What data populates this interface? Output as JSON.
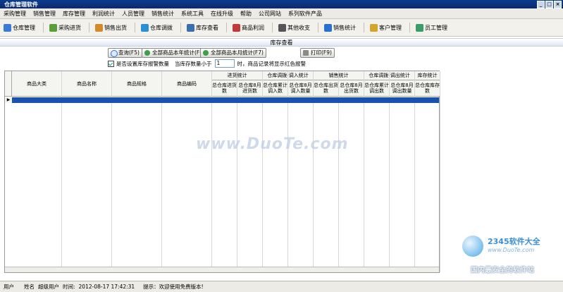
{
  "window": {
    "title": "仓库管理软件",
    "controls": [
      "_",
      "□",
      "×"
    ]
  },
  "menu": [
    "采购管理",
    "销售管理",
    "库存管理",
    "利润统计",
    "人员管理",
    "销售统计",
    "系统工具",
    "在线升级",
    "帮助",
    "公司网站",
    "系列软件产品"
  ],
  "toolbar": [
    {
      "label": "仓库管理",
      "icon": "warehouse-icon",
      "color": "#3a7bd5"
    },
    {
      "label": "采购进货",
      "icon": "purchase-icon",
      "color": "#5a9e3a"
    },
    {
      "label": "销售出货",
      "icon": "sales-icon",
      "color": "#d58a2a"
    },
    {
      "label": "仓库调拨",
      "icon": "transfer-icon",
      "color": "#2a8fd5"
    },
    {
      "label": "库存查看",
      "icon": "stock-icon",
      "color": "#3a6fb0"
    },
    {
      "label": "商品利润",
      "icon": "profit-icon",
      "color": "#c03a3a"
    },
    {
      "label": "其他收支",
      "icon": "ledger-icon",
      "color": "#555555"
    },
    {
      "label": "销售统计",
      "icon": "chart-icon",
      "color": "#2a6fd5"
    },
    {
      "label": "客户管理",
      "icon": "customer-icon",
      "color": "#d5a42a"
    },
    {
      "label": "员工管理",
      "icon": "staff-icon",
      "color": "#3a9e6a"
    }
  ],
  "panel_title": "库存查看",
  "buttons": {
    "query": "查询(F5)",
    "year_stats": "全部商品本年统计(F6)",
    "month_stats": "全部商品本月统计(F7)",
    "print": "打印(F9)"
  },
  "alert_option": {
    "checkbox_label": "是否设置库存报警数量",
    "checked": true,
    "prefix": "当库存数量小于",
    "value": "1",
    "suffix": "时，商品记录将显示红色报警"
  },
  "grid": {
    "columns": [
      "商品大类",
      "商品名称",
      "商品规格",
      "商品编码"
    ],
    "groups": [
      {
        "title": "进货统计",
        "subs": [
          "总仓库进货数",
          "总仓库8月进货数"
        ]
      },
      {
        "title": "仓库调拨-调入统计",
        "subs": [
          "总仓库累计调入数",
          "总仓库8月调入数量"
        ]
      },
      {
        "title": "销售统计",
        "subs": [
          "总仓库出货数",
          "总仓库8月出货数"
        ]
      },
      {
        "title": "仓库调拨-调出统计",
        "subs": [
          "总仓库累计调出数",
          "总仓库8月调出数量"
        ]
      },
      {
        "title": "库存统计",
        "subs": [
          "总仓库库存数"
        ]
      }
    ],
    "row_indicator": "▶"
  },
  "status": {
    "user_label": "用户",
    "name_label": "姓名",
    "name": "超级用户",
    "time_label": "时间:",
    "time": "2012-08-17 17:42:31",
    "tip": "提示：欢迎使用免费版本!"
  },
  "watermark": "www.DuoTe.com",
  "site_logo": {
    "name": "2345软件大全",
    "url": "www.DuoTe.com",
    "slogan": "国内最安全的软件站"
  }
}
